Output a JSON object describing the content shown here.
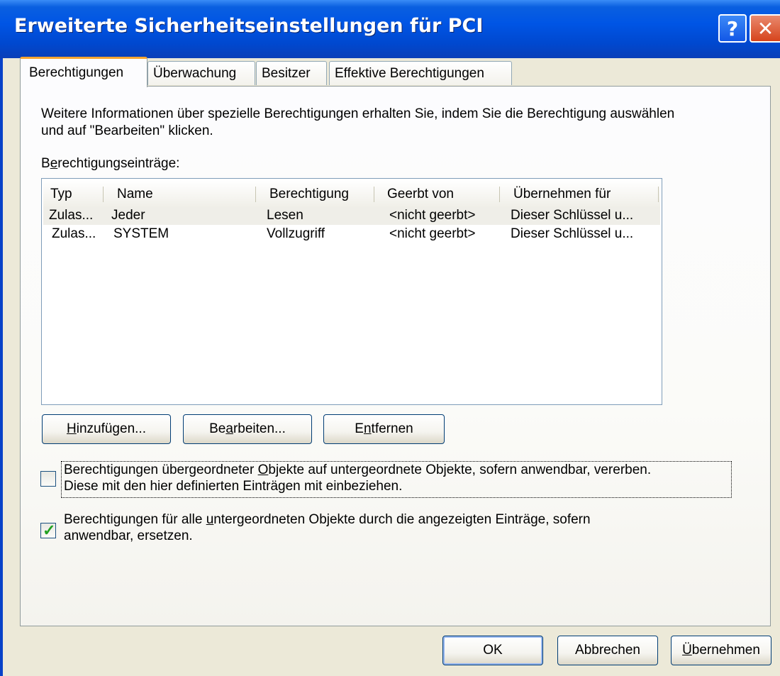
{
  "window": {
    "title": "Erweiterte Sicherheitseinstellungen für PCI",
    "help_glyph": "?",
    "close_glyph": "✕"
  },
  "tabs": [
    {
      "label": "Berechtigungen",
      "active": true
    },
    {
      "label": "Überwachung",
      "active": false
    },
    {
      "label": "Besitzer",
      "active": false
    },
    {
      "label": "Effektive Berechtigungen",
      "active": false
    }
  ],
  "info_text_line1": "Weitere Informationen über spezielle Berechtigungen erhalten Sie, indem Sie die Berechtigung auswählen",
  "info_text_line2": "und auf \"Bearbeiten\" klicken.",
  "entries_label": {
    "pre": "B",
    "accel": "e",
    "post": "rechtigungseinträge:"
  },
  "list": {
    "columns": [
      "Typ",
      "Name",
      "Berechtigung",
      "Geerbt von",
      "Übernehmen für"
    ],
    "rows": [
      [
        "Zulas...",
        "Jeder",
        "Lesen",
        "<nicht geerbt>",
        "Dieser Schlüssel u..."
      ],
      [
        "Zulas...",
        "SYSTEM",
        "Vollzugriff",
        "<nicht geerbt>",
        "Dieser Schlüssel u..."
      ]
    ]
  },
  "buttons": {
    "add": {
      "accel": "H",
      "rest": "inzufügen..."
    },
    "edit": {
      "pre": "Be",
      "accel": "a",
      "rest": "rbeiten..."
    },
    "remove": {
      "pre": "E",
      "accel": "n",
      "rest": "tfernen"
    }
  },
  "checkbox_inherit": {
    "checked": false,
    "line1_pre": "Berechtigungen übergeordneter ",
    "line1_accel": "O",
    "line1_post": "bjekte auf untergeordnete Objekte, sofern anwendbar, vererben.",
    "line2": "Diese mit den hier definierten Einträgen mit einbeziehen."
  },
  "checkbox_replace": {
    "checked": true,
    "line1_pre": "Berechtigungen für alle ",
    "line1_accel": "u",
    "line1_post": "ntergeordneten Objekte durch die angezeigten Einträge, sofern",
    "line2": "anwendbar, ersetzen."
  },
  "footer": {
    "ok": "OK",
    "cancel": "Abbrechen",
    "apply_accel": "Ü",
    "apply_rest": "bernehmen"
  }
}
